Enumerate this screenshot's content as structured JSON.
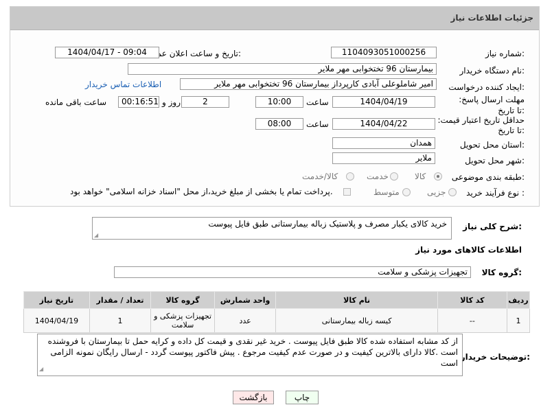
{
  "header": {
    "title": "جزئیات اطلاعات نیاز"
  },
  "fields": {
    "need_number_label": "شماره نیاز:",
    "need_number": "1104093051000256",
    "announce_label": "تاریخ و ساعت اعلان عمومی:",
    "announce_value": "1404/04/17 - 09:04",
    "buyer_org_label": "نام دستگاه خریدار:",
    "buyer_org": "بیمارستان 96 تختخوابی مهر ملایر",
    "requester_label": "ایجاد کننده درخواست:",
    "requester": "امیر شاملوعلی آبادی کارپرداز بیمارستان 96 تختخوابی مهر ملایر",
    "contact_link": "اطلاعات تماس خریدار",
    "deadline_label": "مهلت ارسال پاسخ: تا تاریخ:",
    "deadline_date": "1404/04/19",
    "hour_label": "ساعت",
    "deadline_time": "10:00",
    "days_value": "2",
    "days_label": "روز و",
    "remain_time": "00:16:51",
    "remain_label": "ساعت باقی مانده",
    "min_price_label": "حداقل تاریخ اعتبار قیمت: تا تاریخ:",
    "min_price_date": "1404/04/22",
    "hour_label2": "ساعت",
    "min_price_time": "08:00",
    "province_label": "استان محل تحویل:",
    "province": "همدان",
    "city_label": "شهر محل تحویل:",
    "city": "ملایر",
    "category_label": "طبقه بندی موضوعی:",
    "category_options": [
      "کالا",
      "خدمت",
      "کالا/خدمت"
    ],
    "process_label": "نوع فرآیند خرید :",
    "process_options": [
      "جزیی",
      "متوسط"
    ],
    "payment_note": "پرداخت تمام یا بخشی از مبلغ خرید،از محل \"اسناد خزانه اسلامی\" خواهد بود."
  },
  "description": {
    "label": "شرح کلی نیاز:",
    "value": "خرید  کالای یکبار مصرف و پلاستیک زباله بیمارستانی   طبق فایل پیوست"
  },
  "goods_section": {
    "title": "اطلاعات کالاهای مورد نیاز",
    "group_label": "گروه کالا:",
    "group_value": "تجهیزات پزشکی و سلامت"
  },
  "table": {
    "headers": [
      "ردیف",
      "کد کالا",
      "نام کالا",
      "واحد شمارش",
      "گروه کالا",
      "تعداد / مقدار",
      "تاریخ نیاز"
    ],
    "rows": [
      [
        "1",
        "--",
        "کیسه زباله بیمارستانی",
        "عدد",
        "تجهیزات پزشکی و سلامت",
        "1",
        "1404/04/19"
      ]
    ]
  },
  "buyer_notes": {
    "label": "توضیحات خریدار:",
    "value": "از کد مشابه استفاده شده کالا طبق فایل پیوست . خرید غیر نقدی و قیمت کل داده و کرایه حمل تا بیمارستان با فروشنده است .کالا دارای بالاترین کیفیت و در صورت عدم کیفیت مرجوع  .  پیش فاکتور پیوست گردد - ارسال رایگان نمونه الزامی است"
  },
  "buttons": {
    "print": "چاپ",
    "back": "بازگشت"
  },
  "watermark": "AriaTender.neT"
}
